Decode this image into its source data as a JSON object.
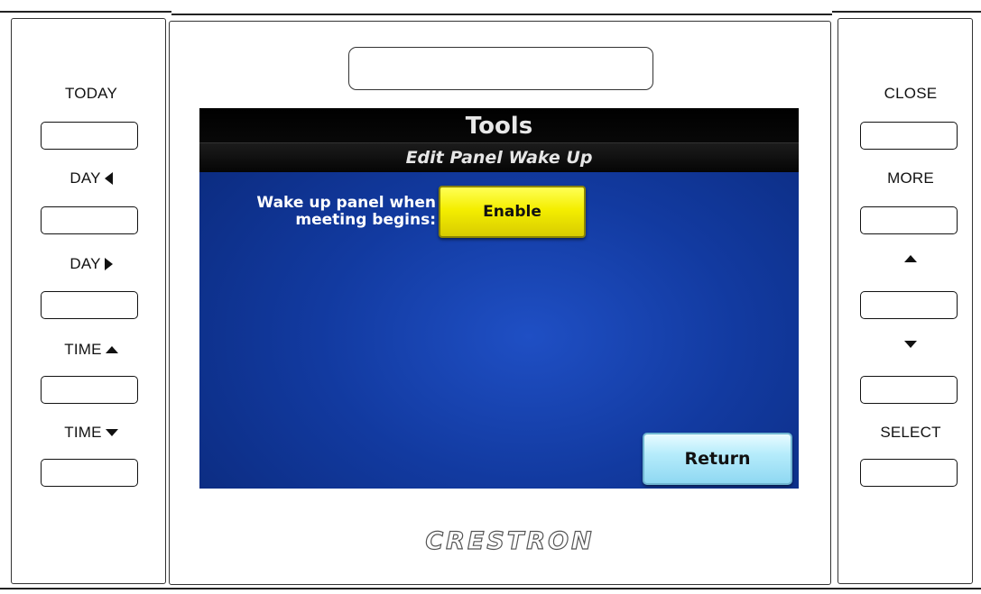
{
  "left_buttons": [
    {
      "label": "TODAY",
      "arrow": ""
    },
    {
      "label": "DAY",
      "arrow": "left"
    },
    {
      "label": "DAY",
      "arrow": "right"
    },
    {
      "label": "TIME",
      "arrow": "up"
    },
    {
      "label": "TIME",
      "arrow": "down"
    }
  ],
  "right_buttons": [
    {
      "label": "CLOSE",
      "arrow": ""
    },
    {
      "label": "MORE",
      "arrow": ""
    },
    {
      "label": "",
      "arrow": "up"
    },
    {
      "label": "",
      "arrow": "down"
    },
    {
      "label": "SELECT",
      "arrow": ""
    }
  ],
  "screen": {
    "title": "Tools",
    "subtitle": "Edit Panel Wake Up",
    "wake_label_line1": "Wake up panel when",
    "wake_label_line2": "meeting begins:",
    "enable_button": "Enable",
    "return_button": "Return"
  },
  "brand": "CRESTRON",
  "colors": {
    "screen_blue": "#123aa0",
    "enable_yellow": "#f4ee00",
    "return_cyan": "#b6ecfb"
  }
}
